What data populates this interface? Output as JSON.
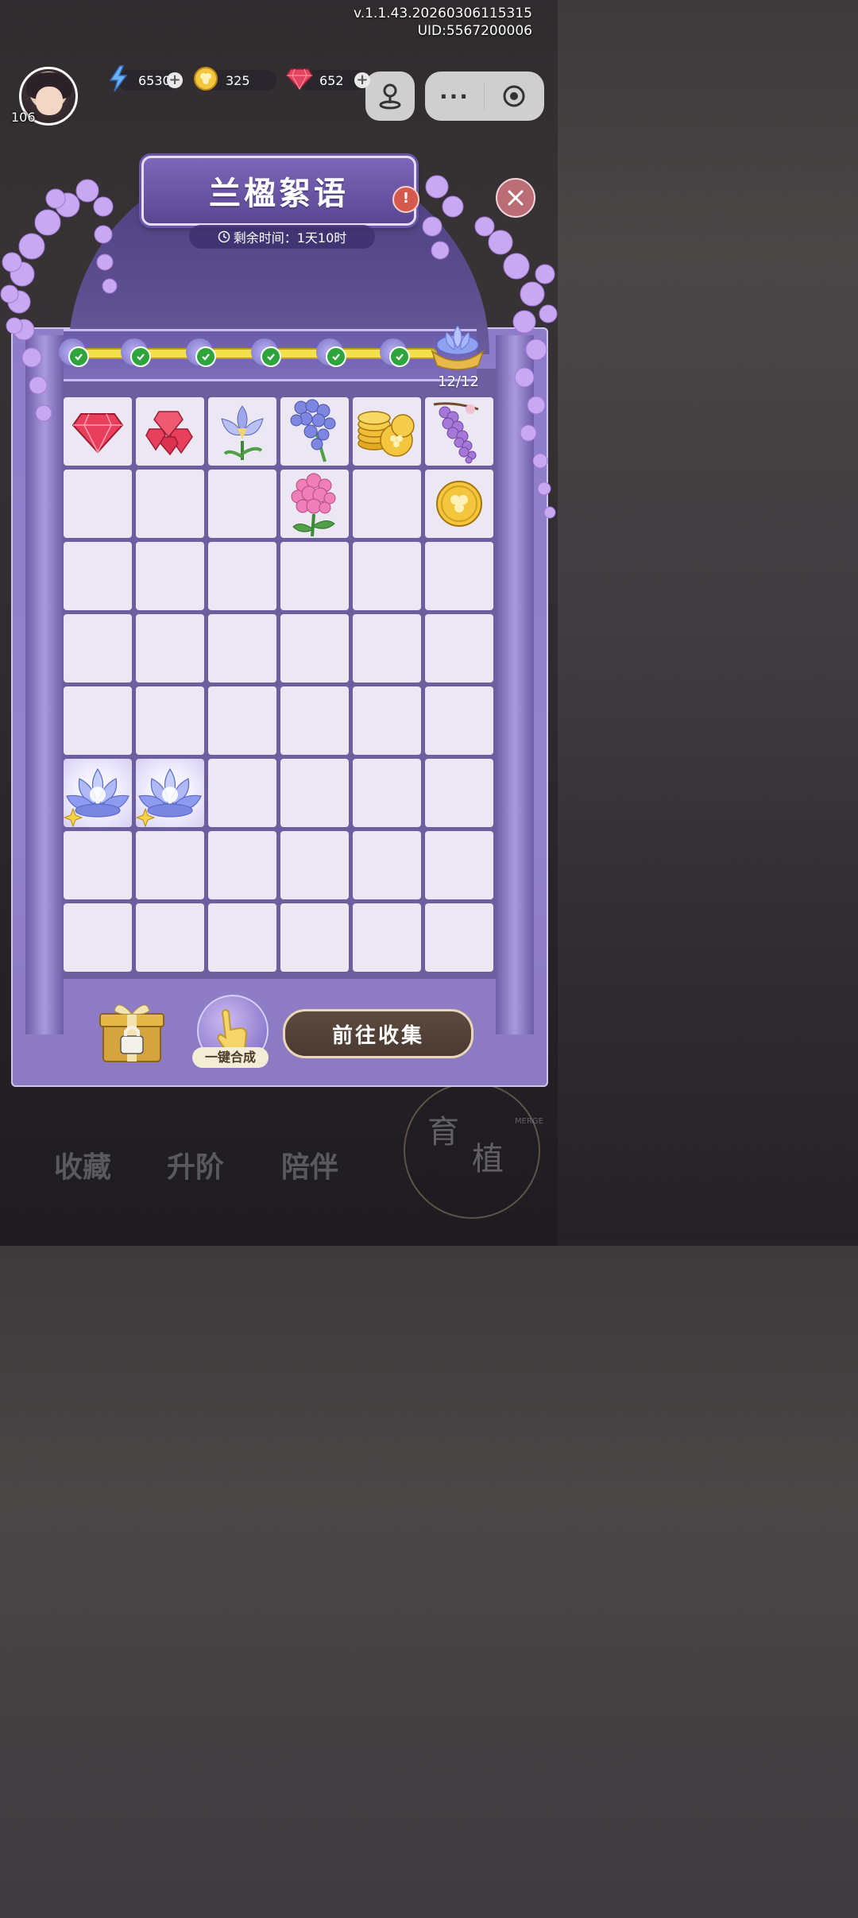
{
  "version": "v.1.1.43.20260306115315",
  "uid": "UID:5567200006",
  "player": {
    "level": "106"
  },
  "resources": {
    "energy": "65301",
    "coins": "325",
    "gems": "652"
  },
  "event": {
    "title": "兰楹絮语",
    "time_label": "剩余时间：1天10时",
    "progress_counter": "12/12",
    "progress_fraction": 1.0
  },
  "grid": {
    "columns": 6,
    "rows": 8,
    "items": [
      [
        "gem",
        "gem-cluster",
        "iris",
        "hyacinth",
        "coin-stack",
        "wisteria"
      ],
      [
        "",
        "",
        "",
        "pink-hydrangea",
        "",
        "coin"
      ],
      [
        "",
        "",
        "",
        "",
        "",
        ""
      ],
      [
        "",
        "",
        "",
        "",
        "",
        ""
      ],
      [
        "",
        "",
        "",
        "",
        "",
        ""
      ],
      [
        "lotus-glow",
        "lotus-glow",
        "",
        "",
        "",
        ""
      ],
      [
        "",
        "",
        "",
        "",
        "",
        ""
      ],
      [
        "",
        "",
        "",
        "",
        "",
        ""
      ]
    ]
  },
  "buttons": {
    "merge_all": "一键合成",
    "go_collect": "前往收集"
  },
  "background_nav": [
    "收藏",
    "升阶",
    "陪伴"
  ],
  "background_badge": {
    "main_left": "育",
    "main_right": "植",
    "sub": "MERGE"
  },
  "colors": {
    "panel": "#9484cc",
    "progress": "#f4e04a",
    "check": "#2ea53c",
    "cell": "#ece8f3"
  }
}
